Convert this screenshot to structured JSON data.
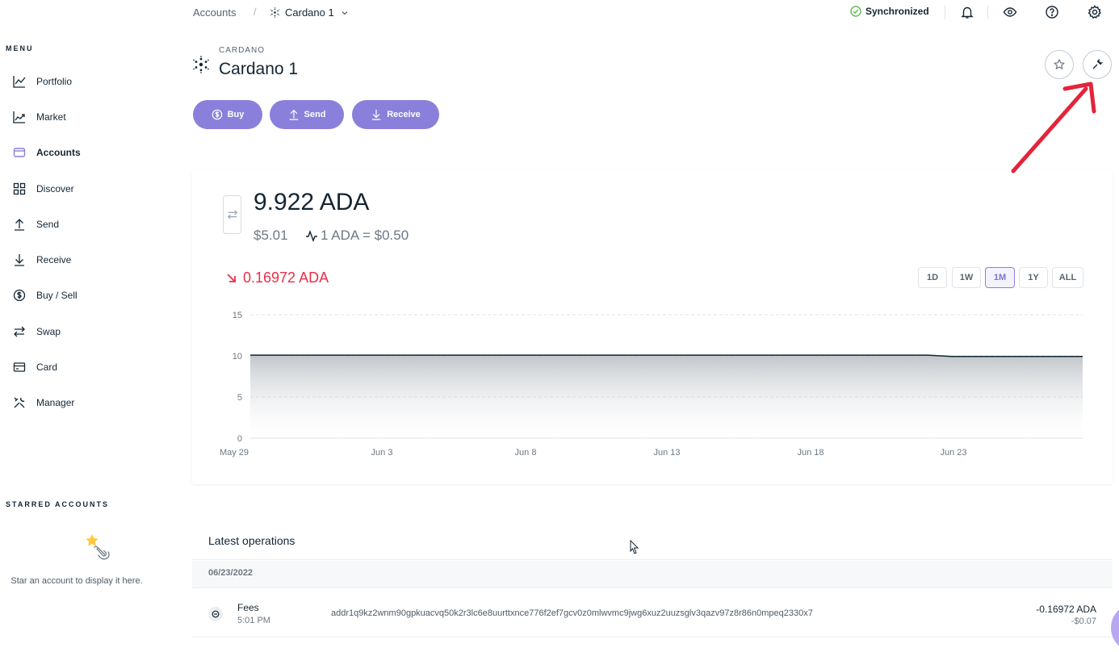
{
  "sidebar": {
    "menu_title": "MENU",
    "items": [
      {
        "label": "Portfolio",
        "icon": "portfolio-icon"
      },
      {
        "label": "Market",
        "icon": "market-icon"
      },
      {
        "label": "Accounts",
        "icon": "wallet-icon",
        "active": true
      },
      {
        "label": "Discover",
        "icon": "grid-icon"
      },
      {
        "label": "Send",
        "icon": "arrow-up-icon"
      },
      {
        "label": "Receive",
        "icon": "arrow-down-icon"
      },
      {
        "label": "Buy / Sell",
        "icon": "dollar-coin-icon"
      },
      {
        "label": "Swap",
        "icon": "swap-icon"
      },
      {
        "label": "Card",
        "icon": "card-icon"
      },
      {
        "label": "Manager",
        "icon": "tools-icon"
      }
    ],
    "starred_title": "STARRED ACCOUNTS",
    "starred_empty": "Star an account to display it here."
  },
  "topbar": {
    "breadcrumb_root": "Accounts",
    "breadcrumb_sep": "/",
    "breadcrumb_account": "Cardano 1",
    "sync_status": "Synchronized"
  },
  "account": {
    "family": "CARDANO",
    "name": "Cardano 1"
  },
  "actions": {
    "buy": "Buy",
    "send": "Send",
    "receive": "Receive"
  },
  "balance": {
    "amount": "9.922 ADA",
    "fiat": "$5.01",
    "rate": "1 ADA = $0.50",
    "delta": "0.16972 ADA"
  },
  "ranges": [
    "1D",
    "1W",
    "1M",
    "1Y",
    "ALL"
  ],
  "selected_range": "1M",
  "chart_data": {
    "type": "area",
    "x": [
      "May 29",
      "Jun 3",
      "Jun 8",
      "Jun 13",
      "Jun 18",
      "Jun 23",
      "Jun 28"
    ],
    "y": [
      10.09,
      10.09,
      10.09,
      10.09,
      10.09,
      9.922,
      9.922
    ],
    "ylim": [
      0,
      15
    ],
    "yticks": [
      "0",
      "5",
      "10",
      "15"
    ],
    "xticks": [
      "May 29",
      "Jun 3",
      "Jun 8",
      "Jun 13",
      "Jun 18",
      "Jun 23"
    ],
    "grid": true
  },
  "operations": {
    "title": "Latest operations",
    "date": "06/23/2022",
    "items": [
      {
        "type": "Fees",
        "time": "5:01 PM",
        "address": "addr1q9kz2wnm90gpkuacvq50k2r3lc6e8uurttxnce776f2ef7gcv0z0mlwvmc9jwg6xuz2uuzsglv3qazv97z8r86n0mpeq2330x7",
        "amount": "-0.16972 ADA",
        "fiat": "-$0.07"
      }
    ]
  },
  "colors": {
    "accent": "#8a80db",
    "negative": "#ea2e49",
    "success": "#66be54",
    "annotation_arrow": "#e3243b"
  }
}
